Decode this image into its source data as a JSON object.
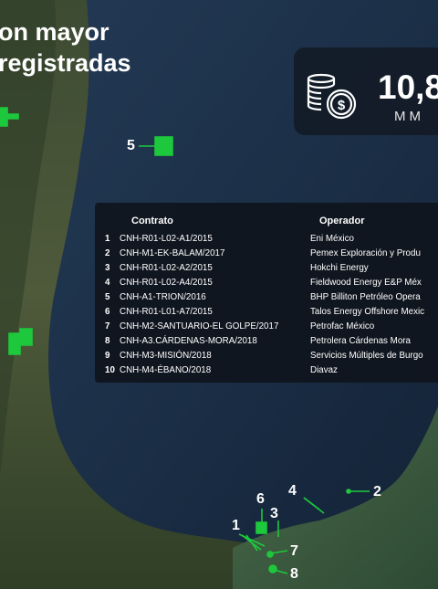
{
  "title": {
    "line1": "on mayor",
    "line2": "registradas"
  },
  "stat": {
    "value": "10,8",
    "unit": "MM",
    "icon": "coins-dollar-icon"
  },
  "table": {
    "headers": {
      "contract": "Contrato",
      "operator": "Operador"
    },
    "rows": [
      {
        "num": "1",
        "contract": "CNH-R01-L02-A1/2015",
        "operator": "Eni México"
      },
      {
        "num": "2",
        "contract": "CNH-M1-EK-BALAM/2017",
        "operator": "Pemex Exploración y Produ"
      },
      {
        "num": "3",
        "contract": "CNH-R01-L02-A2/2015",
        "operator": "Hokchi Energy"
      },
      {
        "num": "4",
        "contract": "CNH-R01-L02-A4/2015",
        "operator": "Fieldwood Energy E&P Méx"
      },
      {
        "num": "5",
        "contract": "CNH-A1-TRION/2016",
        "operator": "BHP Billiton Petróleo Opera"
      },
      {
        "num": "6",
        "contract": "CNH-R01-L01-A7/2015",
        "operator": "Talos Energy Offshore Mexic"
      },
      {
        "num": "7",
        "contract": "CNH-M2-SANTUARIO-EL GOLPE/2017",
        "operator": "Petrofac México"
      },
      {
        "num": "8",
        "contract": "CNH-A3.CÁRDENAS-MORA/2018",
        "operator": "Petrolera Cárdenas Mora"
      },
      {
        "num": "9",
        "contract": "CNH-M3-MISIÓN/2018",
        "operator": "Servicios Múltiples de Burgo"
      },
      {
        "num": "10",
        "contract": "CNH-M4-ÉBANO/2018",
        "operator": "Diavaz"
      }
    ]
  },
  "map_labels": {
    "l1": "1",
    "l2": "2",
    "l3": "3",
    "l4": "4",
    "l5": "5",
    "l6": "6",
    "l7": "7",
    "l8": "8"
  },
  "colors": {
    "marker": "#1ec83c",
    "land": "#3a4a2c",
    "sea": "#1a2d45"
  }
}
